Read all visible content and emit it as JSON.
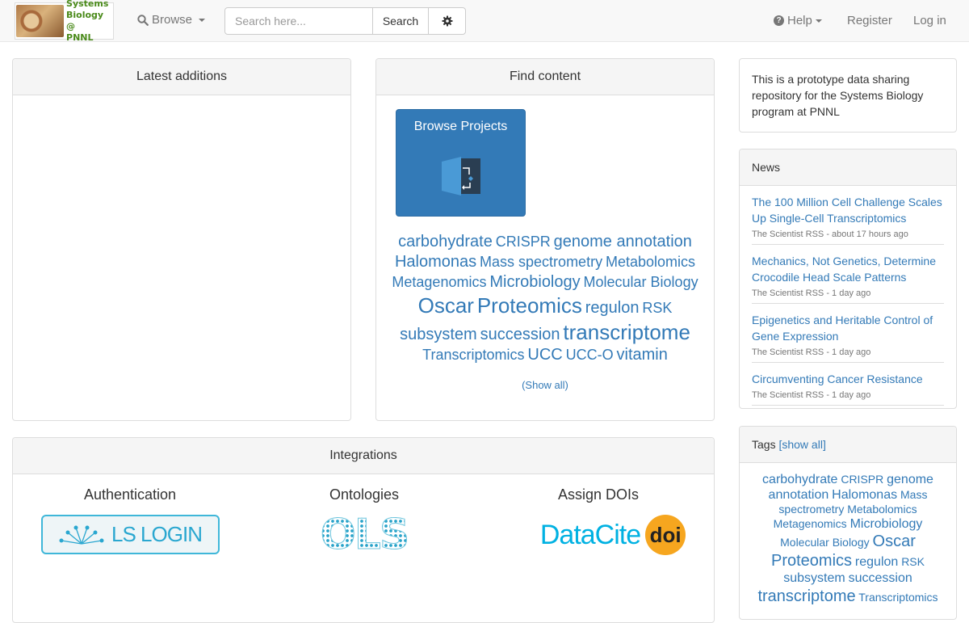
{
  "brand": {
    "text_line1": "Systems",
    "text_line2": "Biology @",
    "text_line3": "PNNL"
  },
  "nav": {
    "browse_label": "Browse",
    "search_placeholder": "Search here...",
    "search_button": "Search",
    "help_label": "Help",
    "register_label": "Register",
    "login_label": "Log in"
  },
  "latest": {
    "title": "Latest additions"
  },
  "find": {
    "title": "Find content",
    "browse_projects": "Browse Projects",
    "tags": [
      {
        "label": "carbohydrate",
        "size": 20
      },
      {
        "label": "CRISPR",
        "size": 18
      },
      {
        "label": "genome annotation",
        "size": 20
      },
      {
        "label": "Halomonas",
        "size": 20
      },
      {
        "label": "Mass spectrometry",
        "size": 18
      },
      {
        "label": "Metabolomics",
        "size": 18
      },
      {
        "label": "Metagenomics",
        "size": 18
      },
      {
        "label": "Microbiology",
        "size": 20
      },
      {
        "label": "Molecular Biology",
        "size": 18
      },
      {
        "label": "Oscar",
        "size": 26
      },
      {
        "label": "Proteomics",
        "size": 26
      },
      {
        "label": "regulon",
        "size": 20
      },
      {
        "label": "RSK",
        "size": 18
      },
      {
        "label": "subsystem",
        "size": 20
      },
      {
        "label": "succession",
        "size": 20
      },
      {
        "label": "transcriptome",
        "size": 26
      },
      {
        "label": "Transcriptomics",
        "size": 18
      },
      {
        "label": "UCC",
        "size": 20
      },
      {
        "label": "UCC-O",
        "size": 18
      },
      {
        "label": "vitamin",
        "size": 20
      }
    ],
    "show_all": "(Show all)"
  },
  "about": {
    "text": "This is a prototype data sharing repository for the Systems Biology program at PNNL"
  },
  "news": {
    "title": "News",
    "items": [
      {
        "title": "The 100 Million Cell Challenge Scales Up Single-Cell Transcriptomics",
        "meta": "The Scientist RSS - about 17 hours ago"
      },
      {
        "title": "Mechanics, Not Genetics, Determine Crocodile Head Scale Patterns",
        "meta": "The Scientist RSS - 1 day ago"
      },
      {
        "title": "Epigenetics and Heritable Control of Gene Expression",
        "meta": "The Scientist RSS - 1 day ago"
      },
      {
        "title": "Circumventing Cancer Resistance",
        "meta": "The Scientist RSS - 1 day ago"
      }
    ]
  },
  "tags_panel": {
    "title": "Tags",
    "show_all": "[show all]",
    "tags": [
      {
        "label": "carbohydrate",
        "size": 16
      },
      {
        "label": "CRISPR",
        "size": 14
      },
      {
        "label": "genome annotation",
        "size": 16
      },
      {
        "label": "Halomonas",
        "size": 16
      },
      {
        "label": "Mass spectrometry",
        "size": 14
      },
      {
        "label": "Metabolomics",
        "size": 14
      },
      {
        "label": "Metagenomics",
        "size": 14
      },
      {
        "label": "Microbiology",
        "size": 16
      },
      {
        "label": "Molecular Biology",
        "size": 14
      },
      {
        "label": "Oscar",
        "size": 20
      },
      {
        "label": "Proteomics",
        "size": 20
      },
      {
        "label": "regulon",
        "size": 16
      },
      {
        "label": "RSK",
        "size": 14
      },
      {
        "label": "subsystem",
        "size": 16
      },
      {
        "label": "succession",
        "size": 16
      },
      {
        "label": "transcriptome",
        "size": 20
      },
      {
        "label": "Transcriptomics",
        "size": 14
      }
    ]
  },
  "integrations": {
    "title": "Integrations",
    "auth": {
      "title": "Authentication",
      "logo_text": "LS LOGIN"
    },
    "ontologies": {
      "title": "Ontologies",
      "logo_text": "OLS"
    },
    "dois": {
      "title": "Assign DOIs",
      "logo_text": "DataCite",
      "badge": "doi"
    }
  },
  "colors": {
    "link": "#337ab7",
    "primary": "#337ab7",
    "panel_heading": "#f5f5f5",
    "border": "#dddddd"
  }
}
